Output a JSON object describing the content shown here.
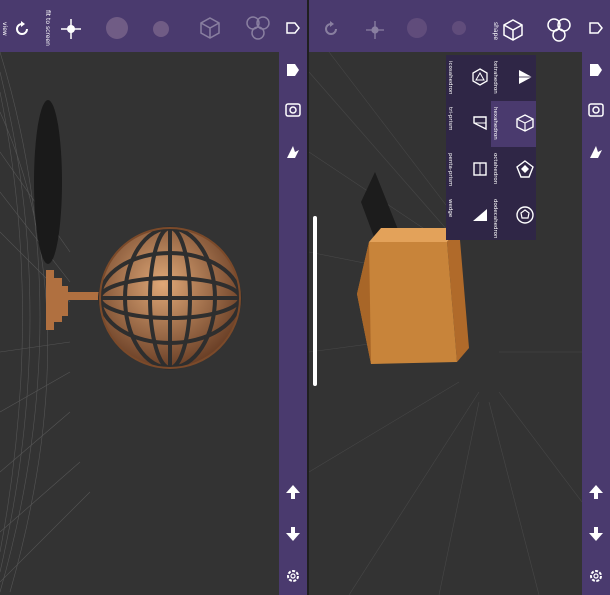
{
  "left_toolbar": {
    "view_label": "view",
    "fit_label": "fit to screen",
    "shape_icon_names": [
      "sphere-icon",
      "small-sphere-icon",
      "box-icon",
      "cluster-icon"
    ]
  },
  "right_toolbar": {
    "shape_label": "shape"
  },
  "shape_menu": {
    "items": [
      {
        "label": "tetrahedron",
        "icon": "tetrahedron-icon"
      },
      {
        "label": "hexahedron",
        "icon": "cube-icon",
        "selected": true
      },
      {
        "label": "octahedron",
        "icon": "octahedron-icon"
      },
      {
        "label": "dodecahedron",
        "icon": "dodecahedron-icon"
      },
      {
        "label": "icosahedron",
        "icon": "icosahedron-icon"
      },
      {
        "label": "tri-prism",
        "icon": "tri-prism-icon"
      },
      {
        "label": "penta-prism",
        "icon": "penta-prism-icon"
      },
      {
        "label": "wedge",
        "icon": "wedge-icon"
      }
    ]
  },
  "colors": {
    "toolbar": "#4a3a6e",
    "viewport": "#333333",
    "wood": "#c8843a",
    "accent_selected": "#4a3a6e"
  }
}
